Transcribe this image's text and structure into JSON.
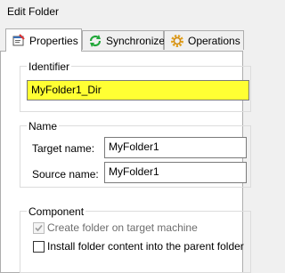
{
  "window": {
    "title": "Edit Folder"
  },
  "tabs": [
    {
      "label": "Properties",
      "icon": "properties-icon",
      "active": true
    },
    {
      "label": "Synchronize",
      "icon": "synchronize-icon",
      "active": false
    },
    {
      "label": "Operations",
      "icon": "gear-icon",
      "active": false
    }
  ],
  "identifier": {
    "group_label": "Identifier",
    "value": "MyFolder1_Dir",
    "highlight_color": "#ffff33"
  },
  "name": {
    "group_label": "Name",
    "target_label": "Target name:",
    "target_value": "MyFolder1",
    "source_label": "Source name:",
    "source_value": "MyFolder1"
  },
  "component": {
    "group_label": "Component",
    "create_folder_label": "Create folder on target machine",
    "create_folder_checked": true,
    "install_content_label": "Install folder content into the parent folder",
    "install_content_checked": false
  },
  "colors": {
    "accent_green": "#22a83a",
    "gear_orange": "#e0a020",
    "disabled_gray": "#6d6d6d"
  }
}
